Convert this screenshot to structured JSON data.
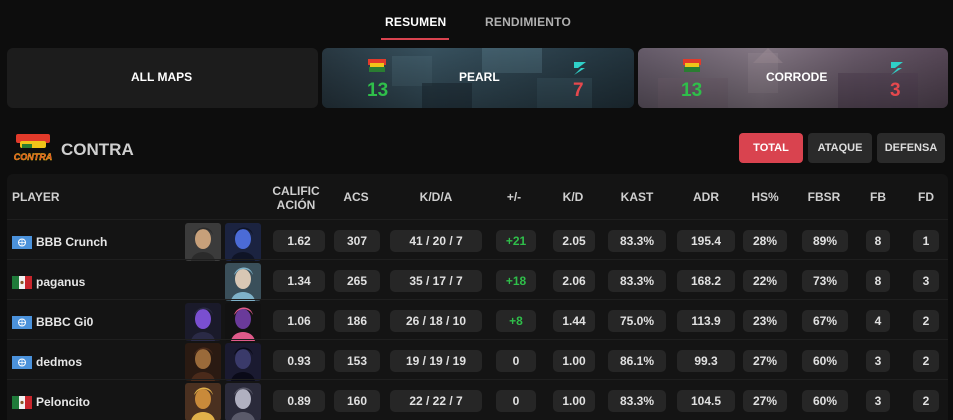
{
  "tabs": [
    {
      "label": "RESUMEN",
      "active": true
    },
    {
      "label": "RENDIMIENTO",
      "active": false
    }
  ],
  "maps": {
    "all": {
      "label": "ALL MAPS"
    },
    "pearl": {
      "name": "PEARL",
      "score_left": "13",
      "score_right": "7"
    },
    "corrode": {
      "name": "CORRODE",
      "score_left": "13",
      "score_right": "3"
    }
  },
  "team": {
    "name": "CONTRA",
    "logo_text": "CONTRA"
  },
  "filters": {
    "total": "TOTAL",
    "ataque": "ATAQUE",
    "defensa": "DEFENSA"
  },
  "columns": {
    "player": "PLAYER",
    "rating_1": "CALIFIC",
    "rating_2": "ACIÓN",
    "acs": "ACS",
    "kda": "K/D/A",
    "pm": "+/-",
    "kd": "K/D",
    "kast": "KAST",
    "adr": "ADR",
    "hs": "HS%",
    "fbsr": "FBSR",
    "fb": "FB",
    "fd": "FD"
  },
  "colors": {
    "accent": "#d9434f",
    "positive": "#2fbf4a",
    "negative": "#e5484d"
  },
  "players": [
    {
      "name": "BBB Crunch",
      "flag": "un",
      "agents": [
        "agent-a",
        "agent-b"
      ],
      "rating": "1.62",
      "acs": "307",
      "kda": "41 / 20 / 7",
      "pm": "+21",
      "pm_positive": true,
      "kd": "2.05",
      "kast": "83.3%",
      "adr": "195.4",
      "hs": "28%",
      "fbsr": "89%",
      "fb": "8",
      "fd": "1"
    },
    {
      "name": "paganus",
      "flag": "mx",
      "agents": [
        "agent-c"
      ],
      "rating": "1.34",
      "acs": "265",
      "kda": "35 / 17 / 7",
      "pm": "+18",
      "pm_positive": true,
      "kd": "2.06",
      "kast": "83.3%",
      "adr": "168.2",
      "hs": "22%",
      "fbsr": "73%",
      "fb": "8",
      "fd": "3"
    },
    {
      "name": "BBBC Gi0",
      "flag": "un",
      "agents": [
        "agent-d",
        "agent-e"
      ],
      "rating": "1.06",
      "acs": "186",
      "kda": "26 / 18 / 10",
      "pm": "+8",
      "pm_positive": true,
      "kd": "1.44",
      "kast": "75.0%",
      "adr": "113.9",
      "hs": "23%",
      "fbsr": "67%",
      "fb": "4",
      "fd": "2"
    },
    {
      "name": "dedmos",
      "flag": "un",
      "agents": [
        "agent-f",
        "agent-g"
      ],
      "rating": "0.93",
      "acs": "153",
      "kda": "19 / 19 / 19",
      "pm": "0",
      "pm_positive": false,
      "kd": "1.00",
      "kast": "86.1%",
      "adr": "99.3",
      "hs": "27%",
      "fbsr": "60%",
      "fb": "3",
      "fd": "2"
    },
    {
      "name": "Peloncito",
      "flag": "mx",
      "agents": [
        "agent-h",
        "agent-i"
      ],
      "rating": "0.89",
      "acs": "160",
      "kda": "22 / 22 / 7",
      "pm": "0",
      "pm_positive": false,
      "kd": "1.00",
      "kast": "83.3%",
      "adr": "104.5",
      "hs": "27%",
      "fbsr": "60%",
      "fb": "3",
      "fd": "2"
    }
  ]
}
